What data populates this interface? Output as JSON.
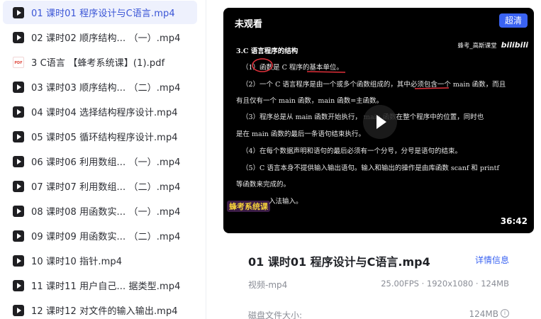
{
  "file_list": [
    {
      "name": "01 课时01 程序设计与C语言.mp4",
      "type": "video",
      "icon": "video-file-icon",
      "active": true
    },
    {
      "name": "02 课时02 顺序结构... （一）.mp4",
      "type": "video",
      "icon": "video-file-icon"
    },
    {
      "name": "3 C语言 【蜂考系统课】(1).pdf",
      "type": "pdf",
      "icon": "pdf-file-icon",
      "icon_text": "PDF"
    },
    {
      "name": "03 课时03 顺序结构... （二）.mp4",
      "type": "video",
      "icon": "video-file-icon"
    },
    {
      "name": "04 课时04 选择结构程序设计.mp4",
      "type": "video",
      "icon": "video-file-icon"
    },
    {
      "name": "05 课时05 循环结构程序设计.mp4",
      "type": "video",
      "icon": "video-file-icon"
    },
    {
      "name": "06 课时06 利用数组... （一）.mp4",
      "type": "video",
      "icon": "video-file-icon"
    },
    {
      "name": "07 课时07 利用数组... （二）.mp4",
      "type": "video",
      "icon": "video-file-icon"
    },
    {
      "name": "08 课时08 用函数实... （一）.mp4",
      "type": "video",
      "icon": "video-file-icon"
    },
    {
      "name": "09 课时09 用函数实... （二）.mp4",
      "type": "video",
      "icon": "video-file-icon"
    },
    {
      "name": "10 课时10 指针.mp4",
      "type": "video",
      "icon": "video-file-icon"
    },
    {
      "name": "11 课时11 用户自己... 据类型.mp4",
      "type": "video",
      "icon": "video-file-icon"
    },
    {
      "name": "12 课时12 对文件的输入输出.mp4",
      "type": "video",
      "icon": "video-file-icon"
    }
  ],
  "player": {
    "status": "未观看",
    "quality_button": "超清",
    "duration": "36:42",
    "watermark_text": "蜂考_高斯课堂",
    "watermark_logo": "bilibili",
    "stamp": "蜂考系统课",
    "slide": {
      "heading": "3.C 语言程序的结构",
      "lines": [
        "（1）函数是 C 程序的基本单位。",
        "（2）一个 C 语言程序是由一个或多个函数组成的，其中必须包含一个 main 函数，而且",
        "有且仅有一个 main 函数，main 函数=主函数。",
        "（3）程序总是从 main 函数开始执行，       main 函数在整个程序中的位置，同时也",
        "是在 main 函数的最后一条语句结束执行。",
        "（4）在每个数据声明和语句的最后必须有一个分号，分号是语句的结束。",
        "（5）C 语言本身不提供输入输出语句。输入和输出的操作是由库函数 scanf 和 printf",
        "等函数来完成的。",
        "入法输入。"
      ]
    }
  },
  "info": {
    "title": "01 课时01 程序设计与C语言.mp4",
    "details_link": "详情信息",
    "media_type": "视频-mp4",
    "spec": "25.00FPS · 1920x1080 · 124MB",
    "size_label": "磁盘文件大小:",
    "size_value": "124MB",
    "info_icon_glyph": "i"
  },
  "colors": {
    "accent": "#3a63f2",
    "active_bg": "#eef1fd",
    "annotation_red": "#e0303a"
  }
}
